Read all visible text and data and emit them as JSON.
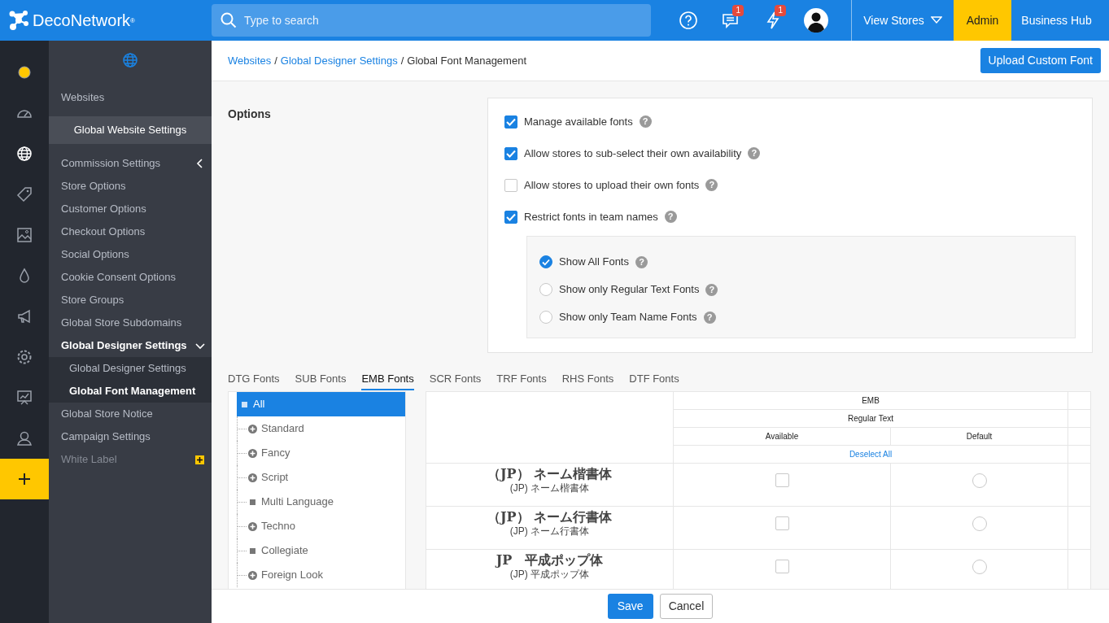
{
  "topbar": {
    "logo": "DecoNetwork",
    "logo_mark": "®",
    "search": {
      "placeholder": "Type to search"
    },
    "messages_badge": "1",
    "alerts_badge": "1",
    "view_stores": "View Stores",
    "admin": "Admin",
    "business_hub": "Business Hub"
  },
  "rail": [
    {
      "kind": "status",
      "selected": false
    },
    {
      "kind": "dashboard",
      "selected": false
    },
    {
      "kind": "globe",
      "selected": true
    },
    {
      "kind": "tag",
      "selected": false
    },
    {
      "kind": "image",
      "selected": false
    },
    {
      "kind": "drop",
      "selected": false
    },
    {
      "kind": "megaphone",
      "selected": false
    },
    {
      "kind": "gear",
      "selected": false
    },
    {
      "kind": "chart",
      "selected": false
    },
    {
      "kind": "user",
      "selected": false
    },
    {
      "kind": "add",
      "selected": false
    }
  ],
  "sidebar": {
    "items": [
      {
        "kind": "heading",
        "label": "Websites",
        "selected": false
      },
      {
        "kind": "banner",
        "label": "Global Website Settings",
        "selected": true
      },
      {
        "kind": "group",
        "label": "Commission Settings",
        "selected": false,
        "expanded": false
      },
      {
        "kind": "item",
        "label": "Store Options",
        "selected": false
      },
      {
        "kind": "item",
        "label": "Customer Options",
        "selected": false
      },
      {
        "kind": "item",
        "label": "Checkout Options",
        "selected": false
      },
      {
        "kind": "item",
        "label": "Social Options",
        "selected": false
      },
      {
        "kind": "item",
        "label": "Cookie Consent Options",
        "selected": false
      },
      {
        "kind": "item",
        "label": "Store Groups",
        "selected": false
      },
      {
        "kind": "item",
        "label": "Global Store Subdomains",
        "selected": false
      },
      {
        "kind": "group",
        "label": "Global Designer Settings",
        "selected": true,
        "expanded": true,
        "children": [
          {
            "label": "Global Designer Settings",
            "selected": false
          },
          {
            "label": "Global Font Management",
            "selected": true
          }
        ]
      },
      {
        "kind": "item",
        "label": "Global Store Notice",
        "selected": false
      },
      {
        "kind": "item",
        "label": "Campaign Settings",
        "selected": false
      },
      {
        "kind": "addon",
        "label": "White Label",
        "selected": false
      }
    ]
  },
  "breadcrumb": [
    {
      "label": "Websites",
      "link": true
    },
    {
      "separator": "/",
      "label": "Global Designer Settings",
      "link": true
    },
    {
      "separator": "/",
      "label": "Global Font Management",
      "link": false
    }
  ],
  "upload_button": "Upload Custom Font",
  "options": {
    "title": "Options",
    "checks": [
      {
        "label": "Manage available fonts",
        "help": "?",
        "checked": true
      },
      {
        "label": "Allow stores to sub-select their own availability",
        "help": "?",
        "checked": true
      },
      {
        "label": "Allow stores to upload their own fonts",
        "help": "?",
        "checked": false
      },
      {
        "label": "Restrict fonts in team names",
        "help": "?",
        "checked": true
      }
    ],
    "radios": [
      {
        "label": "Show All Fonts",
        "help": "?",
        "selected": true
      },
      {
        "label": "Show only Regular Text Fonts",
        "help": "?",
        "selected": false
      },
      {
        "label": "Show only Team Name Fonts",
        "help": "?",
        "selected": false
      }
    ]
  },
  "font_tabs": [
    {
      "label": "DTG Fonts",
      "selected": false
    },
    {
      "label": "SUB Fonts",
      "selected": false
    },
    {
      "label": "EMB Fonts",
      "selected": true
    },
    {
      "label": "SCR Fonts",
      "selected": false
    },
    {
      "label": "TRF Fonts",
      "selected": false
    },
    {
      "label": "RHS Fonts",
      "selected": false
    },
    {
      "label": "DTF Fonts",
      "selected": false
    }
  ],
  "categories": [
    {
      "label": "All",
      "kind": "leaf",
      "selected": true
    },
    {
      "label": "Standard",
      "kind": "expandable",
      "selected": false
    },
    {
      "label": "Fancy",
      "kind": "expandable",
      "selected": false
    },
    {
      "label": "Script",
      "kind": "expandable",
      "selected": false
    },
    {
      "label": "Multi Language",
      "kind": "leaf",
      "selected": false
    },
    {
      "label": "Techno",
      "kind": "expandable",
      "selected": false
    },
    {
      "label": "Collegiate",
      "kind": "leaf",
      "selected": false
    },
    {
      "label": "Foreign Look",
      "kind": "expandable",
      "selected": false
    }
  ],
  "table": {
    "group": "EMB",
    "subgroup": "Regular Text",
    "columns": [
      "Available",
      "Default"
    ],
    "deselect_all": "Deselect All",
    "rows": [
      {
        "title": "（JP） ネーム楷書体",
        "subtitle": "(JP) ネーム楷書体",
        "available": false,
        "default": false
      },
      {
        "title": "（JP） ネーム行書体",
        "subtitle": "(JP) ネーム行書体",
        "available": false,
        "default": false
      },
      {
        "title": "JP　平成ポップ体",
        "subtitle": "(JP) 平成ポップ体",
        "available": false,
        "default": false
      }
    ]
  },
  "footer": {
    "save": "Save",
    "cancel": "Cancel"
  }
}
